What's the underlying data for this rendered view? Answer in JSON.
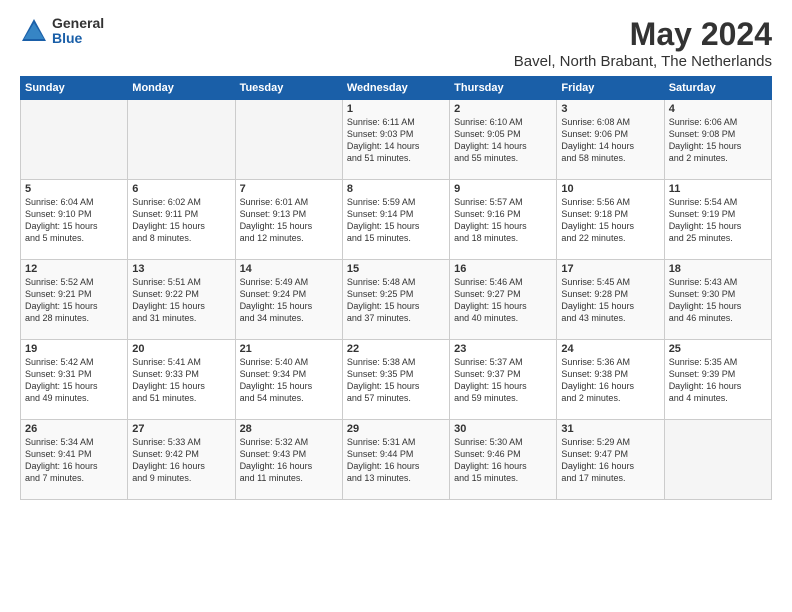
{
  "header": {
    "logo_general": "General",
    "logo_blue": "Blue",
    "title": "May 2024",
    "subtitle": "Bavel, North Brabant, The Netherlands"
  },
  "weekdays": [
    "Sunday",
    "Monday",
    "Tuesday",
    "Wednesday",
    "Thursday",
    "Friday",
    "Saturday"
  ],
  "weeks": [
    [
      {
        "day": "",
        "content": ""
      },
      {
        "day": "",
        "content": ""
      },
      {
        "day": "",
        "content": ""
      },
      {
        "day": "1",
        "content": "Sunrise: 6:11 AM\nSunset: 9:03 PM\nDaylight: 14 hours\nand 51 minutes."
      },
      {
        "day": "2",
        "content": "Sunrise: 6:10 AM\nSunset: 9:05 PM\nDaylight: 14 hours\nand 55 minutes."
      },
      {
        "day": "3",
        "content": "Sunrise: 6:08 AM\nSunset: 9:06 PM\nDaylight: 14 hours\nand 58 minutes."
      },
      {
        "day": "4",
        "content": "Sunrise: 6:06 AM\nSunset: 9:08 PM\nDaylight: 15 hours\nand 2 minutes."
      }
    ],
    [
      {
        "day": "5",
        "content": "Sunrise: 6:04 AM\nSunset: 9:10 PM\nDaylight: 15 hours\nand 5 minutes."
      },
      {
        "day": "6",
        "content": "Sunrise: 6:02 AM\nSunset: 9:11 PM\nDaylight: 15 hours\nand 8 minutes."
      },
      {
        "day": "7",
        "content": "Sunrise: 6:01 AM\nSunset: 9:13 PM\nDaylight: 15 hours\nand 12 minutes."
      },
      {
        "day": "8",
        "content": "Sunrise: 5:59 AM\nSunset: 9:14 PM\nDaylight: 15 hours\nand 15 minutes."
      },
      {
        "day": "9",
        "content": "Sunrise: 5:57 AM\nSunset: 9:16 PM\nDaylight: 15 hours\nand 18 minutes."
      },
      {
        "day": "10",
        "content": "Sunrise: 5:56 AM\nSunset: 9:18 PM\nDaylight: 15 hours\nand 22 minutes."
      },
      {
        "day": "11",
        "content": "Sunrise: 5:54 AM\nSunset: 9:19 PM\nDaylight: 15 hours\nand 25 minutes."
      }
    ],
    [
      {
        "day": "12",
        "content": "Sunrise: 5:52 AM\nSunset: 9:21 PM\nDaylight: 15 hours\nand 28 minutes."
      },
      {
        "day": "13",
        "content": "Sunrise: 5:51 AM\nSunset: 9:22 PM\nDaylight: 15 hours\nand 31 minutes."
      },
      {
        "day": "14",
        "content": "Sunrise: 5:49 AM\nSunset: 9:24 PM\nDaylight: 15 hours\nand 34 minutes."
      },
      {
        "day": "15",
        "content": "Sunrise: 5:48 AM\nSunset: 9:25 PM\nDaylight: 15 hours\nand 37 minutes."
      },
      {
        "day": "16",
        "content": "Sunrise: 5:46 AM\nSunset: 9:27 PM\nDaylight: 15 hours\nand 40 minutes."
      },
      {
        "day": "17",
        "content": "Sunrise: 5:45 AM\nSunset: 9:28 PM\nDaylight: 15 hours\nand 43 minutes."
      },
      {
        "day": "18",
        "content": "Sunrise: 5:43 AM\nSunset: 9:30 PM\nDaylight: 15 hours\nand 46 minutes."
      }
    ],
    [
      {
        "day": "19",
        "content": "Sunrise: 5:42 AM\nSunset: 9:31 PM\nDaylight: 15 hours\nand 49 minutes."
      },
      {
        "day": "20",
        "content": "Sunrise: 5:41 AM\nSunset: 9:33 PM\nDaylight: 15 hours\nand 51 minutes."
      },
      {
        "day": "21",
        "content": "Sunrise: 5:40 AM\nSunset: 9:34 PM\nDaylight: 15 hours\nand 54 minutes."
      },
      {
        "day": "22",
        "content": "Sunrise: 5:38 AM\nSunset: 9:35 PM\nDaylight: 15 hours\nand 57 minutes."
      },
      {
        "day": "23",
        "content": "Sunrise: 5:37 AM\nSunset: 9:37 PM\nDaylight: 15 hours\nand 59 minutes."
      },
      {
        "day": "24",
        "content": "Sunrise: 5:36 AM\nSunset: 9:38 PM\nDaylight: 16 hours\nand 2 minutes."
      },
      {
        "day": "25",
        "content": "Sunrise: 5:35 AM\nSunset: 9:39 PM\nDaylight: 16 hours\nand 4 minutes."
      }
    ],
    [
      {
        "day": "26",
        "content": "Sunrise: 5:34 AM\nSunset: 9:41 PM\nDaylight: 16 hours\nand 7 minutes."
      },
      {
        "day": "27",
        "content": "Sunrise: 5:33 AM\nSunset: 9:42 PM\nDaylight: 16 hours\nand 9 minutes."
      },
      {
        "day": "28",
        "content": "Sunrise: 5:32 AM\nSunset: 9:43 PM\nDaylight: 16 hours\nand 11 minutes."
      },
      {
        "day": "29",
        "content": "Sunrise: 5:31 AM\nSunset: 9:44 PM\nDaylight: 16 hours\nand 13 minutes."
      },
      {
        "day": "30",
        "content": "Sunrise: 5:30 AM\nSunset: 9:46 PM\nDaylight: 16 hours\nand 15 minutes."
      },
      {
        "day": "31",
        "content": "Sunrise: 5:29 AM\nSunset: 9:47 PM\nDaylight: 16 hours\nand 17 minutes."
      },
      {
        "day": "",
        "content": ""
      }
    ]
  ]
}
